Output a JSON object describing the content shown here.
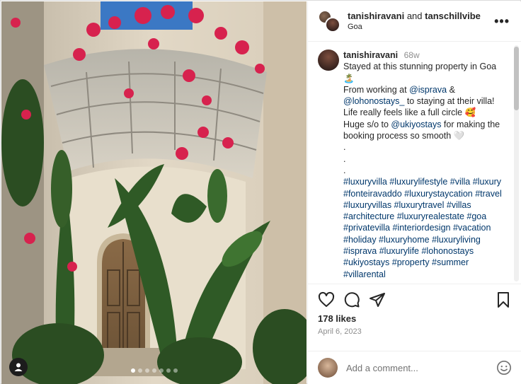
{
  "post": {
    "header": {
      "user1": "tanishiravani",
      "joiner": "and",
      "user2": "tanschillvibe",
      "location": "Goa"
    },
    "caption": {
      "username": "tanishiravani",
      "time": "68w",
      "line1": "Stayed at this stunning property in Goa 🏝️",
      "from_working_at": "From working at ",
      "mention_isprava": "@isprava",
      "amp": " &",
      "mention_lohono": "@lohonostays_",
      "staying_text": " to staying at their villa! Life really feels like a full circle 🥰",
      "huge_so": "Huge s/o to ",
      "mention_ukiyo": "@ukiyostays",
      "booking_text": " for making the booking process so smooth 🤍",
      "dot": ".",
      "hashtags": "#luxuryvilla #luxurylifestyle #villa #luxury #fonteiravaddo #luxurystaycation #travel #luxuryvillas #luxurytravel #villas #architecture #luxuryrealestate #goa #privatevilla #interiordesign #vacation #holiday #luxuryhome #luxuryliving #isprava #luxurylife #lohonostays #ukiyostays #property #summer #villarental"
    },
    "likes": "178 likes",
    "date": "April 6, 2023",
    "comment_placeholder": "Add a comment...",
    "carousel": {
      "count": 7,
      "active_index": 0
    }
  },
  "icons": {
    "more": "more-options-icon",
    "like": "heart-icon",
    "comment": "comment-icon",
    "share": "send-icon",
    "save": "bookmark-icon",
    "emoji": "smiley-icon",
    "profile": "user-icon"
  },
  "colors": {
    "link": "#00376b",
    "muted": "#8e8e8e",
    "text": "#262626",
    "border": "#dbdbdb"
  }
}
